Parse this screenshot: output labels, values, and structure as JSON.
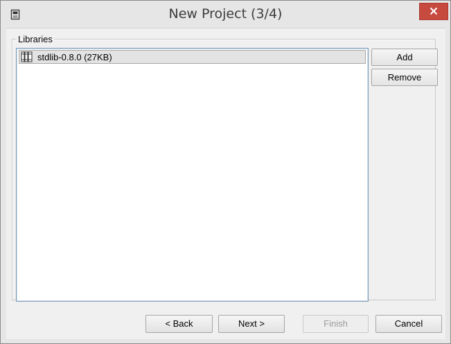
{
  "window": {
    "title": "New Project (3/4)",
    "icons": {
      "app": "document-icon",
      "close": "close-icon"
    },
    "colors": {
      "close_button": "#c74a3f"
    }
  },
  "libraries": {
    "legend": "Libraries",
    "items": [
      {
        "label": "stdlib-0.8.0 (27KB)",
        "icon": "library-books-icon",
        "selected": true
      }
    ],
    "add_label": "Add",
    "remove_label": "Remove"
  },
  "footer": {
    "back_label": "< Back",
    "next_label": "Next >",
    "finish_label": "Finish",
    "finish_enabled": false,
    "cancel_label": "Cancel"
  }
}
